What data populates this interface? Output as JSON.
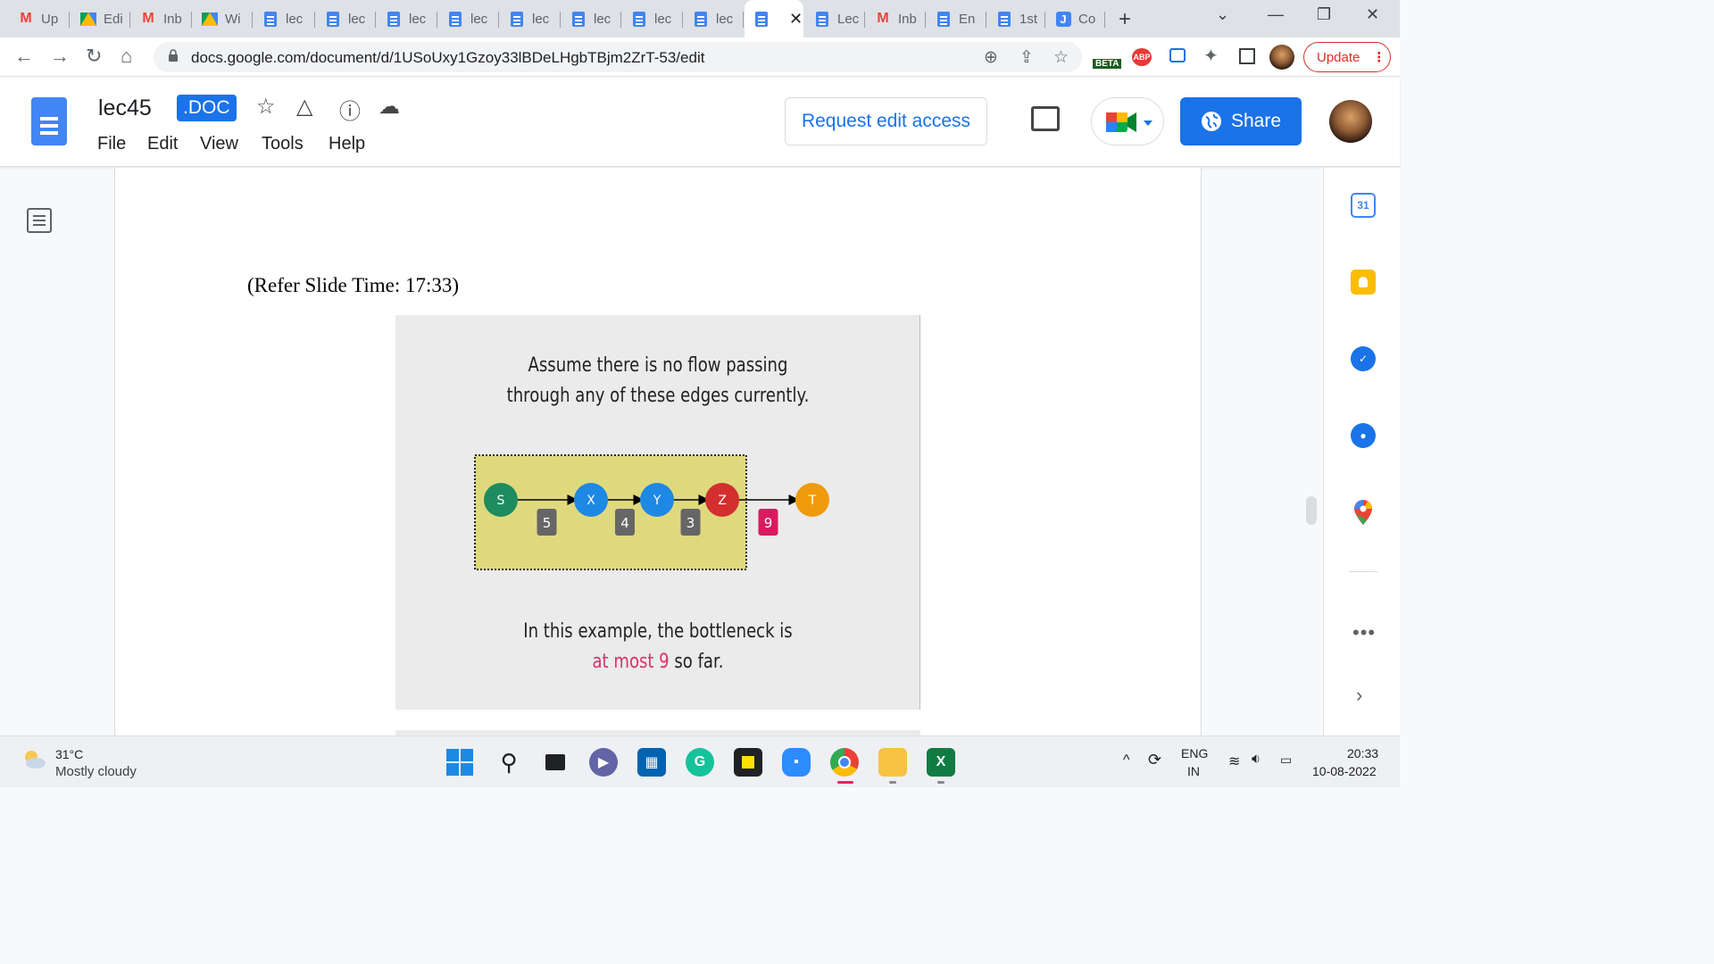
{
  "tabs": [
    {
      "label": "Up",
      "icon": "gmail-icon"
    },
    {
      "label": "Edi",
      "icon": "drive-icon"
    },
    {
      "label": "Inb",
      "icon": "gmail-icon"
    },
    {
      "label": "Wi",
      "icon": "drive-icon"
    },
    {
      "label": "lec",
      "icon": "docs-icon"
    },
    {
      "label": "lec",
      "icon": "docs-icon"
    },
    {
      "label": "lec",
      "icon": "docs-icon"
    },
    {
      "label": "lec",
      "icon": "docs-icon"
    },
    {
      "label": "lec",
      "icon": "docs-icon"
    },
    {
      "label": "lec",
      "icon": "docs-icon"
    },
    {
      "label": "lec",
      "icon": "docs-icon"
    },
    {
      "label": "lec",
      "icon": "docs-icon"
    },
    {
      "label": "",
      "icon": "docs-icon",
      "active": true
    },
    {
      "label": "Lec",
      "icon": "docs-icon"
    },
    {
      "label": "Inb",
      "icon": "gmail-icon"
    },
    {
      "label": "En",
      "icon": "docs-icon"
    },
    {
      "label": "1st",
      "icon": "docs-icon"
    },
    {
      "label": "Co",
      "icon": "j-icon"
    }
  ],
  "browser": {
    "url": "docs.google.com/document/d/1USoUxy1Gzoy33lBDeLHgbTBjm2ZrT-53/edit",
    "update_label": "Update",
    "beta_badge": "BETA",
    "abp_badge": "ABP"
  },
  "doc": {
    "title": "lec45",
    "badge": ".DOC",
    "menu": [
      "File",
      "Edit",
      "View",
      "Tools",
      "Help"
    ],
    "request_edit_label": "Request edit access",
    "share_label": "Share"
  },
  "content": {
    "refer_text": "(Refer Slide Time: 17:33)",
    "slide": {
      "top_line1": "Assume there is no flow passing",
      "top_line2": "through any of these edges currently.",
      "bottom_line1": "In this example, the bottleneck is",
      "bottom_line2_highlight": "at most 9",
      "bottom_line2_rest": " so far.",
      "nodes": [
        {
          "label": "S",
          "color": "#1e8c5e"
        },
        {
          "label": "X",
          "color": "#1e88e5"
        },
        {
          "label": "Y",
          "color": "#1e88e5"
        },
        {
          "label": "Z",
          "color": "#d32f2f"
        },
        {
          "label": "T",
          "color": "#ef9a0c"
        }
      ],
      "edges": [
        {
          "label": "5",
          "color": "#666666"
        },
        {
          "label": "4",
          "color": "#666666"
        },
        {
          "label": "3",
          "color": "#666666"
        },
        {
          "label": "9",
          "color": "#d81b60"
        }
      ],
      "highlight_box_color": "#dfd97e"
    }
  },
  "sidepanel": {
    "calendar_label": "31",
    "icons": [
      "calendar-icon",
      "keep-icon",
      "tasks-icon",
      "contacts-icon",
      "maps-icon"
    ]
  },
  "taskbar": {
    "temperature": "31°C",
    "weather": "Mostly cloudy",
    "lang_top": "ENG",
    "lang_bottom": "IN",
    "time": "20:33",
    "date": "10-08-2022",
    "apps": [
      "windows-start-icon",
      "search-icon",
      "task-view-icon",
      "teams-chat-icon",
      "store-icon",
      "grammarly-icon",
      "sticky-notes-icon",
      "zoom-icon",
      "chrome-icon",
      "file-explorer-icon",
      "excel-icon"
    ]
  }
}
